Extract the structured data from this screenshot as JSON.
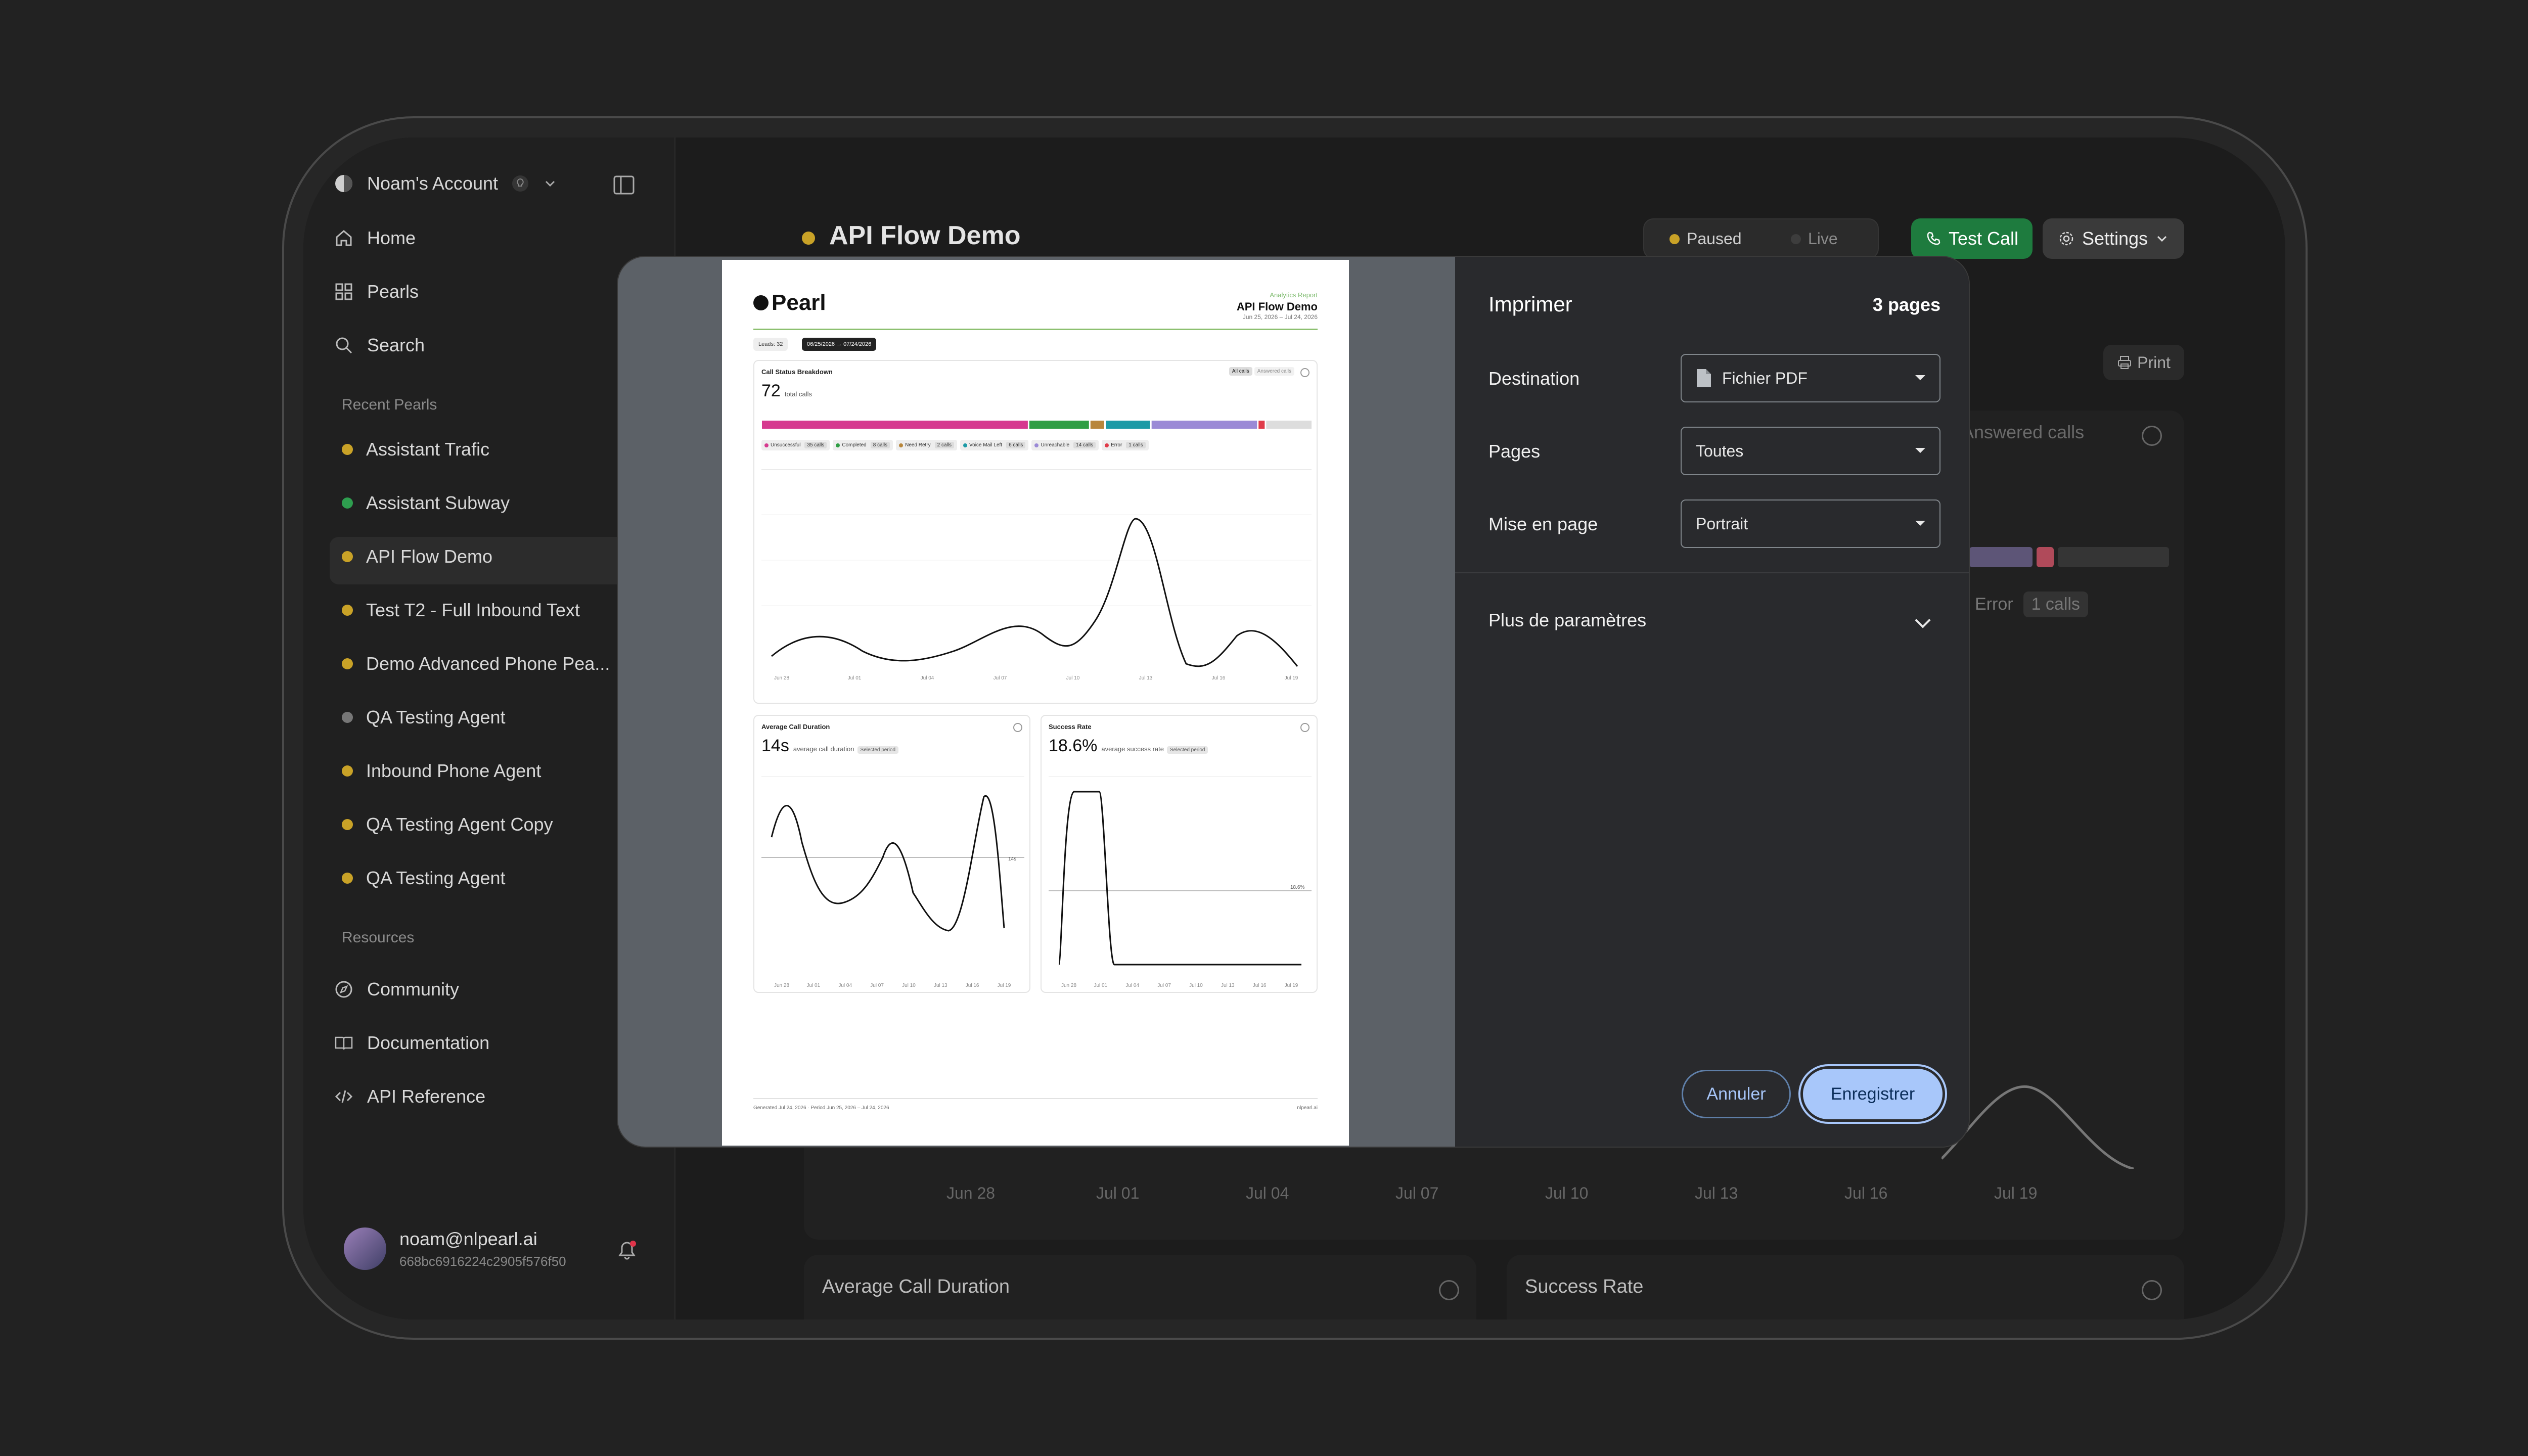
{
  "sidebar": {
    "account_name": "Noam's Account",
    "nav": [
      {
        "label": "Home",
        "icon": "home-icon"
      },
      {
        "label": "Pearls",
        "icon": "grid-icon"
      },
      {
        "label": "Search",
        "icon": "search-icon"
      }
    ],
    "recent_heading": "Recent Pearls",
    "recent": [
      {
        "label": "Assistant Trafic",
        "color": "#c9a227"
      },
      {
        "label": "Assistant Subway",
        "color": "#2e9e4f"
      },
      {
        "label": "API Flow Demo",
        "color": "#c9a227"
      },
      {
        "label": "Test T2 - Full Inbound Text",
        "color": "#c9a227"
      },
      {
        "label": "Demo Advanced Phone Pea...",
        "color": "#c9a227"
      },
      {
        "label": "QA Testing Agent",
        "color": "#777777"
      },
      {
        "label": "Inbound Phone Agent",
        "color": "#c9a227"
      },
      {
        "label": "QA Testing Agent Copy",
        "color": "#c9a227"
      },
      {
        "label": "QA Testing Agent",
        "color": "#c9a227"
      }
    ],
    "resources_heading": "Resources",
    "resources": [
      {
        "label": "Community",
        "icon": "compass-icon"
      },
      {
        "label": "Documentation",
        "icon": "book-icon"
      },
      {
        "label": "API Reference",
        "icon": "code-icon"
      }
    ],
    "user": {
      "email": "noam@nlpearl.ai",
      "id": "668bc6916224c2905f576f50"
    }
  },
  "header": {
    "title": "API Flow Demo",
    "paused": "Paused",
    "live": "Live",
    "test_call": "Test Call",
    "settings": "Settings",
    "print": "Print"
  },
  "background": {
    "answered_calls": "Answered calls",
    "error_label": "Error",
    "error_count": "1 calls",
    "axis": [
      "Jun 28",
      "Jul 01",
      "Jul 04",
      "Jul 07",
      "Jul 10",
      "Jul 13",
      "Jul 16",
      "Jul 19"
    ],
    "card_avg": "Average Call Duration",
    "card_success": "Success Rate"
  },
  "print_dialog": {
    "title": "Imprimer",
    "pages_count": "3 pages",
    "destination_label": "Destination",
    "destination_value": "Fichier PDF",
    "pages_label": "Pages",
    "pages_value": "Toutes",
    "layout_label": "Mise en page",
    "layout_value": "Portrait",
    "more_settings": "Plus de paramètres",
    "cancel": "Annuler",
    "save": "Enregistrer"
  },
  "preview": {
    "logo": "Pearl",
    "report_kicker": "Analytics Report",
    "report_title": "API Flow Demo",
    "report_dates": "Jun 25, 2026 – Jul 24, 2026",
    "chip_leads": "Leads: 32",
    "chip_range": "06/25/2026 → 07/24/2026",
    "status_card": {
      "title": "Call Status Breakdown",
      "total": "72",
      "total_label": "total calls",
      "toggle_all": "All calls",
      "toggle_answered": "Answered calls",
      "legend": [
        {
          "label": "Unsuccessful",
          "count": "35 calls",
          "color": "#d63a8f"
        },
        {
          "label": "Completed",
          "count": "8 calls",
          "color": "#2f9e44"
        },
        {
          "label": "Need Retry",
          "count": "2 calls",
          "color": "#b8863b"
        },
        {
          "label": "Voice Mail Left",
          "count": "6 calls",
          "color": "#1c9aa6"
        },
        {
          "label": "Unreachable",
          "count": "14 calls",
          "color": "#9b8ad6"
        },
        {
          "label": "Error",
          "count": "1 calls",
          "color": "#e03c4a"
        }
      ],
      "axis": [
        "Jun 28",
        "Jul 01",
        "Jul 04",
        "Jul 07",
        "Jul 10",
        "Jul 13",
        "Jul 16",
        "Jul 19"
      ]
    },
    "avg_card": {
      "title": "Average Call Duration",
      "value": "14s",
      "label": "average call duration",
      "tag": "Selected period",
      "ref_label": "14s",
      "axis": [
        "Jun 28",
        "Jul 01",
        "Jul 04",
        "Jul 07",
        "Jul 10",
        "Jul 13",
        "Jul 16",
        "Jul 19"
      ]
    },
    "success_card": {
      "title": "Success Rate",
      "value": "18.6%",
      "label": "average success rate",
      "tag": "Selected period",
      "ref_label": "18.6%",
      "axis": [
        "Jun 28",
        "Jul 01",
        "Jul 04",
        "Jul 07",
        "Jul 10",
        "Jul 13",
        "Jul 16",
        "Jul 19"
      ]
    },
    "footer_left": "Generated Jul 24, 2026 · Period Jun 25, 2026 – Jul 24, 2026",
    "footer_right": "nlpearl.ai"
  }
}
